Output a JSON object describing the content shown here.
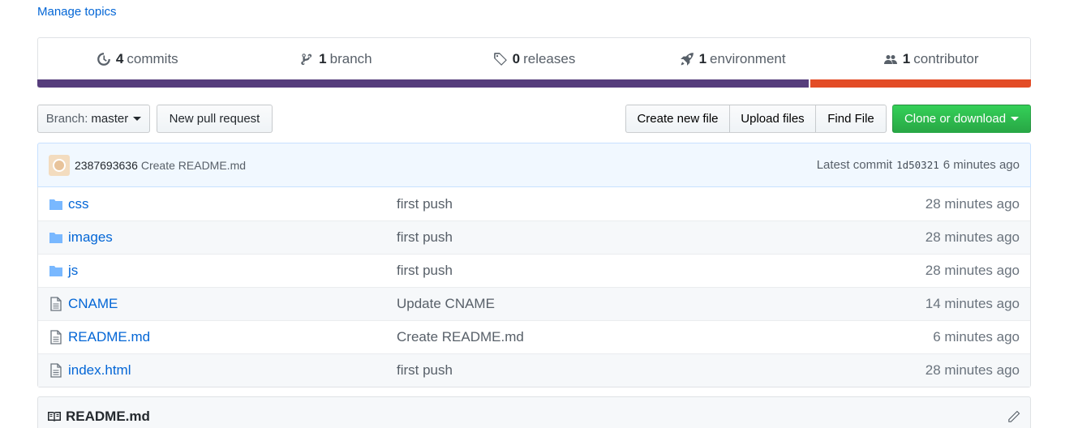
{
  "manage_topics": "Manage topics",
  "summary": {
    "commits": {
      "count": "4",
      "label": "commits"
    },
    "branches": {
      "count": "1",
      "label": "branch"
    },
    "releases": {
      "count": "0",
      "label": "releases"
    },
    "environments": {
      "count": "1",
      "label": "environment"
    },
    "contributors": {
      "count": "1",
      "label": "contributor"
    }
  },
  "language_bar": [
    {
      "color": "#563d7c",
      "fraction": 0.776
    },
    {
      "color": "#e34c26",
      "fraction": 0.224
    }
  ],
  "toolbar": {
    "branch_prefix": "Branch:",
    "branch_name": "master",
    "new_pr": "New pull request",
    "create_file": "Create new file",
    "upload_files": "Upload files",
    "find_file": "Find File",
    "clone": "Clone or download"
  },
  "commit": {
    "author": "2387693636",
    "message": "Create README.md",
    "latest_label": "Latest commit",
    "sha": "1d50321",
    "age": "6 minutes ago"
  },
  "files": [
    {
      "type": "folder",
      "name": "css",
      "message": "first push",
      "age": "28 minutes ago"
    },
    {
      "type": "folder",
      "name": "images",
      "message": "first push",
      "age": "28 minutes ago"
    },
    {
      "type": "folder",
      "name": "js",
      "message": "first push",
      "age": "28 minutes ago"
    },
    {
      "type": "file",
      "name": "CNAME",
      "message": "Update CNAME",
      "age": "14 minutes ago"
    },
    {
      "type": "file",
      "name": "README.md",
      "message": "Create README.md",
      "age": "6 minutes ago"
    },
    {
      "type": "file",
      "name": "index.html",
      "message": "first push",
      "age": "28 minutes ago"
    }
  ],
  "readme": {
    "title": "README.md"
  },
  "colors": {
    "link": "#0366d6",
    "clone_button": "#28a745",
    "folder_icon": "#79b8ff"
  }
}
